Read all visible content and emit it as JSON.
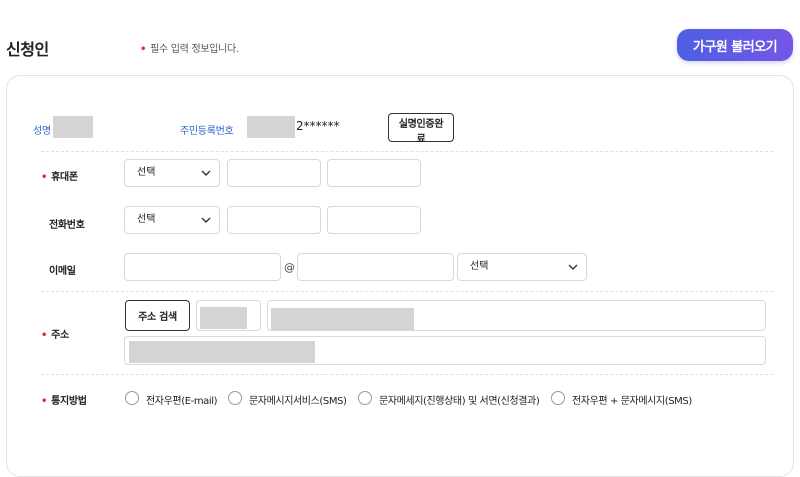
{
  "header": {
    "title": "신청인",
    "required_note": "필수 입력 정보입니다.",
    "load_button": "가구원 불러오기"
  },
  "identity": {
    "name_label": "성명",
    "rrn_label": "주민등록번호",
    "rrn_suffix": "2******",
    "verify_button": "실명인증완료"
  },
  "phone": {
    "label": "휴대폰",
    "required": true,
    "select_value": "선택"
  },
  "telephone": {
    "label": "전화번호",
    "select_value": "선택"
  },
  "email": {
    "label": "이메일",
    "at": "@",
    "select_value": "선택"
  },
  "address": {
    "label": "주소",
    "required": true,
    "search_button": "주소 검색"
  },
  "notify": {
    "label": "통지방법",
    "required": true,
    "options": [
      "전자우편(E-mail)",
      "문자메시지서비스(SMS)",
      "문자메세지(진행상태) 및 서면(신청결과)",
      "전자우편 + 문자메시지(SMS)"
    ]
  },
  "colors": {
    "accent_gradient_start": "#4c5fe4",
    "accent_gradient_end": "#7656e6",
    "required_dot": "#e0292f",
    "link_blue": "#2a63c9"
  }
}
